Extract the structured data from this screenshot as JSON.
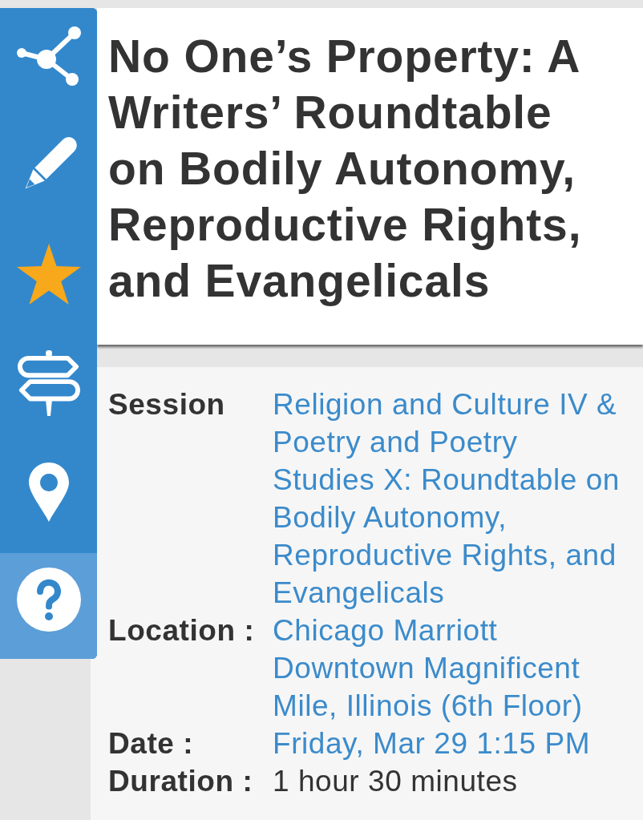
{
  "sidebar": {
    "items": [
      {
        "kind": "share",
        "selected": false,
        "on": false
      },
      {
        "kind": "edit",
        "selected": false,
        "on": false
      },
      {
        "kind": "star",
        "selected": false,
        "on": true
      },
      {
        "kind": "signpost",
        "selected": false,
        "on": false
      },
      {
        "kind": "location",
        "selected": false,
        "on": false
      },
      {
        "kind": "help",
        "selected": true,
        "on": false
      }
    ]
  },
  "title": "No One’s Property: A Writers’ Roundtable on Bodily Autonomy, Reproductive Rights, and Evangelicals",
  "details": [
    {
      "label": "Session",
      "value": "Religion and Culture IV & Poetry and Poetry Studies X: Roundtable on Bodily Autonomy, Reproductive Rights, and Evangelicals",
      "link": true
    },
    {
      "label": "Location :",
      "value": "Chicago Marriott Downtown Magnificent Mile, Illinois (6th Floor)",
      "link": true
    },
    {
      "label": "Date :",
      "value": "Friday, Mar 29 1:15 PM",
      "link": true
    },
    {
      "label": "Duration :",
      "value": "1 hour 30 minutes",
      "link": false
    }
  ]
}
